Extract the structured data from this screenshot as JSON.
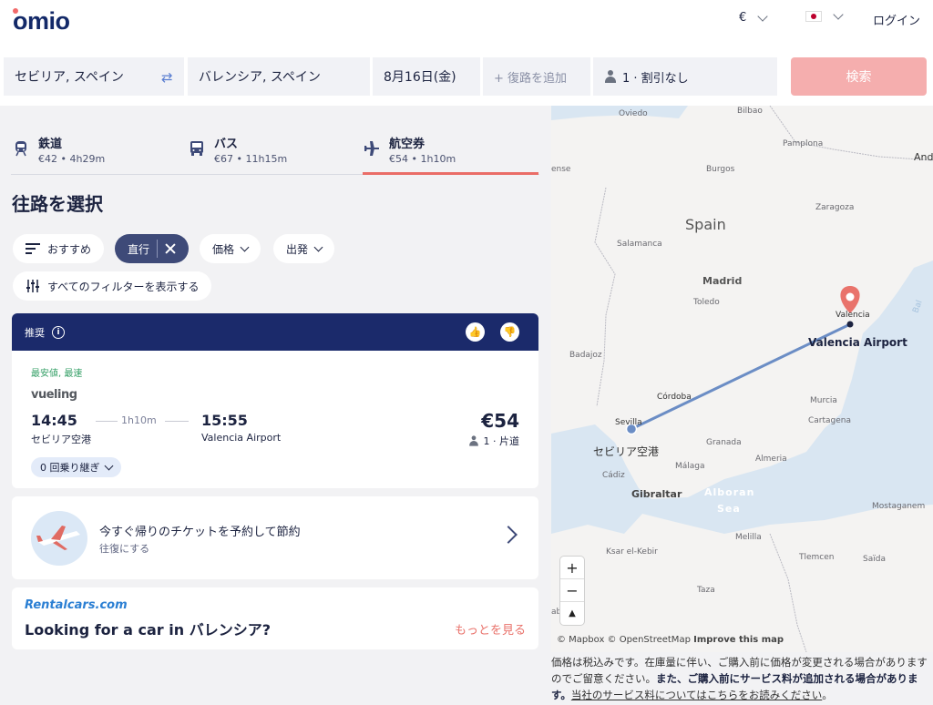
{
  "header": {
    "logo": "omio",
    "currency": "€",
    "login": "ログイン"
  },
  "search": {
    "from": "セビリア, スペイン",
    "to": "バレンシア, スペイン",
    "date": "8月16日(金)",
    "return_placeholder": "+ 復路を追加",
    "passengers": "1 · 割引なし",
    "search_button": "検索"
  },
  "tabs": [
    {
      "label": "鉄道",
      "sub": "€42 • 4h29m"
    },
    {
      "label": "バス",
      "sub": "€67 • 11h15m"
    },
    {
      "label": "航空券",
      "sub": "€54 • 1h10m"
    }
  ],
  "section_title": "往路を選択",
  "filters": {
    "sort": "おすすめ",
    "direct": "直行",
    "price": "価格",
    "departure": "出発",
    "all_filters": "すべてのフィルターを表示する"
  },
  "result": {
    "badge": "推奨",
    "tag": "最安値, 最速",
    "airline": "vueling",
    "depart_time": "14:45",
    "depart_place": "セビリア空港",
    "duration": "1h10m",
    "arrive_time": "15:55",
    "arrive_place": "Valencia Airport",
    "price": "€54",
    "pax": "1 · 片道",
    "transfers": "0 回乗り継ぎ"
  },
  "promo": {
    "title": "今すぐ帰りのチケットを予約して節約",
    "subtitle": "往復にする"
  },
  "rentalcars": {
    "logo": "Rentalcars.com",
    "title": "Looking for a car in バレンシア?",
    "link": "もっとを見る"
  },
  "map": {
    "labels": {
      "oviedo": "Oviedo",
      "bilbao": "Bilbao",
      "pamplona": "Pamplona",
      "burgos": "Burgos",
      "ense": "ense",
      "and": "And",
      "zaragoza": "Zaragoza",
      "spain": "Spain",
      "salamanca": "Salamanca",
      "madrid": "Madrid",
      "toledo": "Toledo",
      "valencia": "Valencia",
      "valencia_airport": "Valencia Airport",
      "badajoz": "Badajoz",
      "cordoba": "Córdoba",
      "murcia": "Murcia",
      "cartagena": "Cartagena",
      "sevilla": "Sevilla",
      "sevilla_airport": "セビリア空港",
      "granada": "Granada",
      "almeria": "Almeria",
      "malaga": "Málaga",
      "cadiz": "Cádiz",
      "gibraltar": "Gibraltar",
      "alboran": "Alboran",
      "sea": "Sea",
      "mostaganem": "Mostaganem",
      "melilla": "Melilla",
      "tlemcen": "Tlemcen",
      "saida": "Saïda",
      "ksar": "Ksar el-Kebir",
      "taza": "Taza",
      "bal": "Bal",
      "rabat": "abat"
    },
    "attribution_a": "© Mapbox © OpenStreetMap ",
    "attribution_b": "Improve this map",
    "zoom_in": "+",
    "zoom_out": "−"
  },
  "note": {
    "part1": "価格は税込みです。在庫量に伴い、ご購入前に価格が変更される場合がありますのでご留意ください。",
    "part2": "また、ご購入前にサービス料が追加される場合があります。",
    "link": "当社のサービス料についてはこちらをお読みください",
    "end": "。"
  },
  "colors": {
    "brand_navy": "#132968",
    "accent_coral": "#ea6d67",
    "search_button": "#f5aeae",
    "card_header": "#1b2a6b"
  }
}
